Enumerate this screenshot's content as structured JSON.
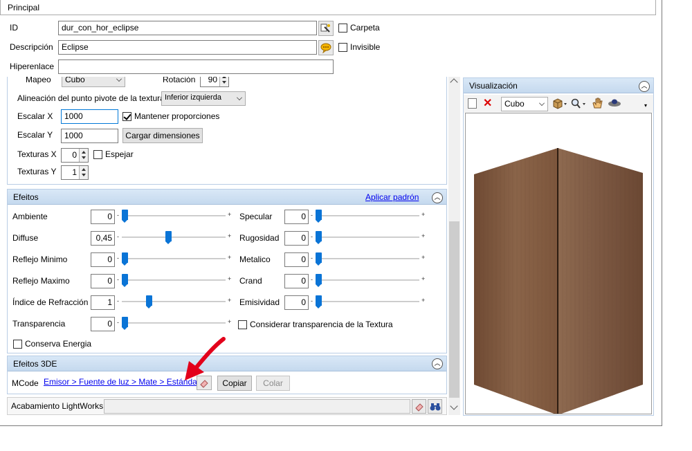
{
  "principal": {
    "label": "Principal"
  },
  "id": {
    "label": "ID",
    "value": "dur_con_hor_eclipse"
  },
  "carpeta": {
    "label": "Carpeta"
  },
  "descripcion": {
    "label": "Descripción",
    "value": "Eclipse"
  },
  "invisible": {
    "label": "Invisible"
  },
  "hiperenlace": {
    "label": "Hiperenlace",
    "value": ""
  },
  "texture": {
    "mapeo_label": "Mapeo",
    "mapeo_value": "Cubo",
    "rotacion_label": "Rotación",
    "rotacion_value": "90",
    "alineacion_label": "Alineación del punto pivote de la textura",
    "alineacion_value": "Inferior izquierda",
    "escalar_x_label": "Escalar X",
    "escalar_x_value": "1000",
    "mantener_label": "Mantener proporciones",
    "escalar_y_label": "Escalar Y",
    "escalar_y_value": "1000",
    "cargar_label": "Cargar dimensiones",
    "texturas_x_label": "Texturas X",
    "texturas_x_value": "0",
    "espejar_label": "Espejar",
    "texturas_y_label": "Texturas Y",
    "texturas_y_value": "1"
  },
  "efeitos": {
    "title": "Efeitos",
    "aplicar": "Aplicar padrón",
    "left": [
      {
        "label": "Ambiente",
        "value": "0",
        "level": 0
      },
      {
        "label": "Diffuse",
        "value": "0,45",
        "level": 0.45
      },
      {
        "label": "Reflejo Minimo",
        "value": "0",
        "level": 0
      },
      {
        "label": "Reflejo Maximo",
        "value": "0",
        "level": 0
      },
      {
        "label": "Índice de Refracción",
        "value": "1",
        "level": 0.25
      },
      {
        "label": "Transparencia",
        "value": "0",
        "level": 0
      }
    ],
    "right": [
      {
        "label": "Specular",
        "value": "0",
        "level": 0
      },
      {
        "label": "Rugosidad",
        "value": "0",
        "level": 0
      },
      {
        "label": "Metalico",
        "value": "0",
        "level": 0
      },
      {
        "label": "Crand",
        "value": "0",
        "level": 0
      },
      {
        "label": "Emisividad",
        "value": "0",
        "level": 0
      }
    ],
    "minus": "-",
    "plus": "+",
    "considerar": "Considerar transparencia de la Textura",
    "conserva": "Conserva Energia"
  },
  "efeitos3de": {
    "title": "Efeitos 3DE",
    "mcode_label": "MCode",
    "mcode_link": "Emisor > Fuente de luz > Mate > Estándar",
    "copiar": "Copiar",
    "colar": "Colar"
  },
  "acabamento": {
    "label": "Acabamiento LightWorks",
    "value": ""
  },
  "visualizacion": {
    "title": "Visualización",
    "view_mode": "Cubo"
  },
  "colors": {
    "accent": "#0a74d6",
    "header": "#c5d9ee",
    "wood": "#8b6244",
    "arrow": "#e3001b"
  }
}
